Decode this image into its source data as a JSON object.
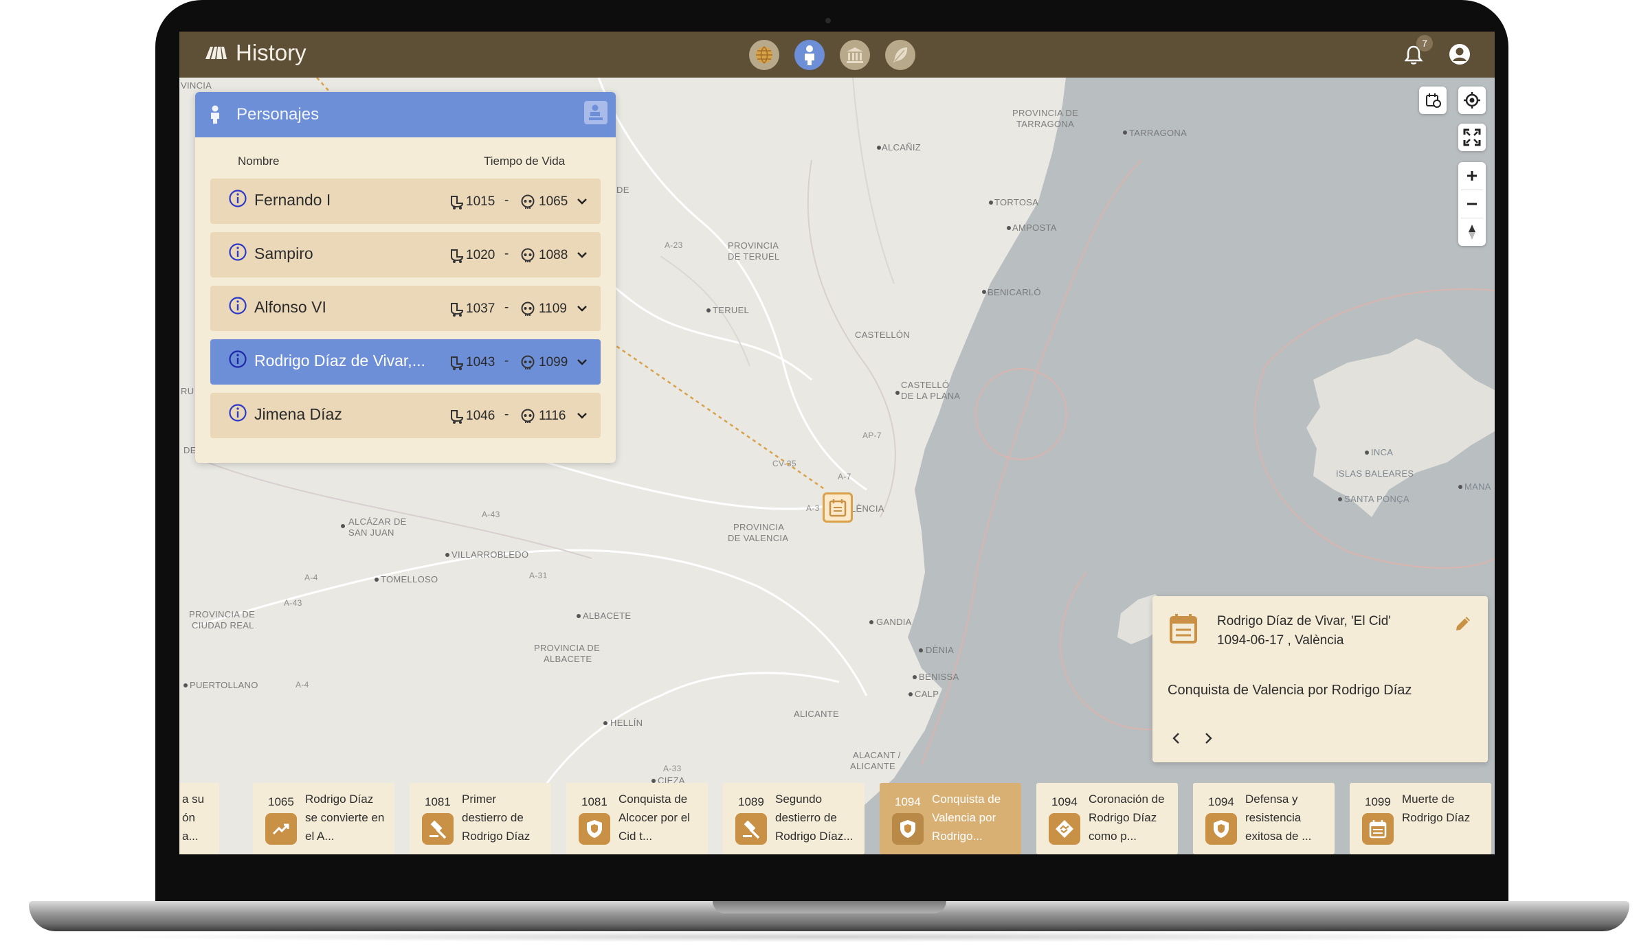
{
  "app": {
    "title": "History",
    "notification_count": "7"
  },
  "modes": [
    {
      "name": "globe",
      "active": false
    },
    {
      "name": "characters",
      "active": true
    },
    {
      "name": "museum",
      "active": false
    },
    {
      "name": "feather",
      "active": false
    }
  ],
  "panel": {
    "title": "Personajes",
    "col_name": "Nombre",
    "col_life": "Tiempo de Vida",
    "rows": [
      {
        "name": "Fernando I",
        "birth": "1015",
        "death": "1065",
        "selected": false
      },
      {
        "name": "Sampiro",
        "birth": "1020",
        "death": "1088",
        "selected": false
      },
      {
        "name": "Alfonso VI",
        "birth": "1037",
        "death": "1109",
        "selected": false
      },
      {
        "name": "Rodrigo Díaz de Vivar,...",
        "birth": "1043",
        "death": "1099",
        "selected": true
      },
      {
        "name": "Jimena Díaz",
        "birth": "1046",
        "death": "1116",
        "selected": false
      }
    ],
    "dash": "-"
  },
  "event_card": {
    "who": "Rodrigo Díaz de Vivar, 'El Cid'",
    "when": "1094-06-17 , València",
    "description": "Conquista de Valencia por Rodrigo Díaz"
  },
  "timeline": {
    "partial": {
      "text_lines": [
        "a su",
        "ón",
        "a..."
      ]
    },
    "items": [
      {
        "year": "1065",
        "lines": [
          "Rodrigo Díaz",
          "se convierte en",
          "el A..."
        ],
        "icon": "trending-up-icon",
        "active": false
      },
      {
        "year": "1081",
        "lines": [
          "Primer",
          "destierro de",
          "Rodrigo Díaz"
        ],
        "icon": "gavel-icon",
        "active": false
      },
      {
        "year": "1081",
        "lines": [
          "Conquista de",
          "Alcocer por el",
          "Cid t..."
        ],
        "icon": "shield-icon",
        "active": false
      },
      {
        "year": "1089",
        "lines": [
          "Segundo",
          "destierro de",
          "Rodrigo Díaz..."
        ],
        "icon": "gavel-icon",
        "active": false
      },
      {
        "year": "1094",
        "lines": [
          "Conquista de",
          "Valencia por",
          "Rodrigo..."
        ],
        "icon": "shield-icon",
        "active": true
      },
      {
        "year": "1094",
        "lines": [
          "Coronación de",
          "Rodrigo Díaz",
          "como p..."
        ],
        "icon": "handshake-icon",
        "active": false
      },
      {
        "year": "1094",
        "lines": [
          "Defensa y",
          "resistencia",
          "exitosa de ..."
        ],
        "icon": "shield-icon",
        "active": false
      },
      {
        "year": "1099",
        "lines": [
          "Muerte de",
          "Rodrigo Díaz"
        ],
        "icon": "calendar-icon",
        "active": false
      }
    ]
  },
  "map_labels": {
    "alcaniz": "ALCAÑIZ",
    "prov_tarragona_1": "PROVINCIA DE",
    "prov_tarragona_2": "TARRAGONA",
    "tarragona": "TARRAGONA",
    "tortosa": "TORTOSA",
    "amposta": "AMPOSTA",
    "prov_teruel_1": "PROVINCIA",
    "prov_teruel_2": "DE TERUEL",
    "teruel": "TERUEL",
    "benicarlo": "BENICARLÓ",
    "castellon": "CASTELLÓN",
    "castello_1": "CASTELLÓ",
    "castello_2": "DE LA PLANA",
    "valencia": "VALÈNCIA",
    "prov_valencia_1": "PROVINCIA",
    "prov_valencia_2": "DE VALENCIA",
    "alcazar_1": "ALCÁZAR DE",
    "alcazar_2": "SAN JUAN",
    "villarrobledo": "VILLARROBLEDO",
    "tomelloso": "TOMELLOSO",
    "albacete": "ALBACETE",
    "prov_albacete_1": "PROVINCIA DE",
    "prov_albacete_2": "ALBACETE",
    "prov_ciudad_real_1": "PROVINCIA DE",
    "prov_ciudad_real_2": "CIUDAD REAL",
    "puertollano": "PUERTOLLANO",
    "gandia": "GANDIA",
    "denia": "DÈNIA",
    "benissa": "BENISSA",
    "calp": "CALP",
    "hellin": "HELLÍN",
    "alicante": "ALICANTE",
    "alacant_1": "ALACANT /",
    "alacant_2": "ALICANTE",
    "cieza": "CIEZA",
    "inca": "INCA",
    "islas_baleares": "ISLAS BALEARES",
    "santa_ponca": "SANTA PONÇA",
    "manacor": "MANA",
    "vincia": "VINCIA",
    "de": "DE",
    "ru": "RU",
    "de2": "DE",
    "a23": "A-23",
    "a7": "AP-7",
    "cv35": "CV-35",
    "a3": "A-3",
    "a43a": "A-43",
    "a4": "A-4",
    "a43b": "A-43",
    "a31": "A-31",
    "a4b": "A-4",
    "a33": "A-33",
    "a7b": "A-7"
  },
  "colors": {
    "topbar": "#5e5037",
    "accent_blue": "#6d8fd8",
    "card_bg": "#f5ecd7",
    "row_bg": "#ead8b8",
    "timeline_active": "#d9b074",
    "icon_gold": "#c99145",
    "sea": "#b7bcbe",
    "land": "#e9e8e3"
  }
}
